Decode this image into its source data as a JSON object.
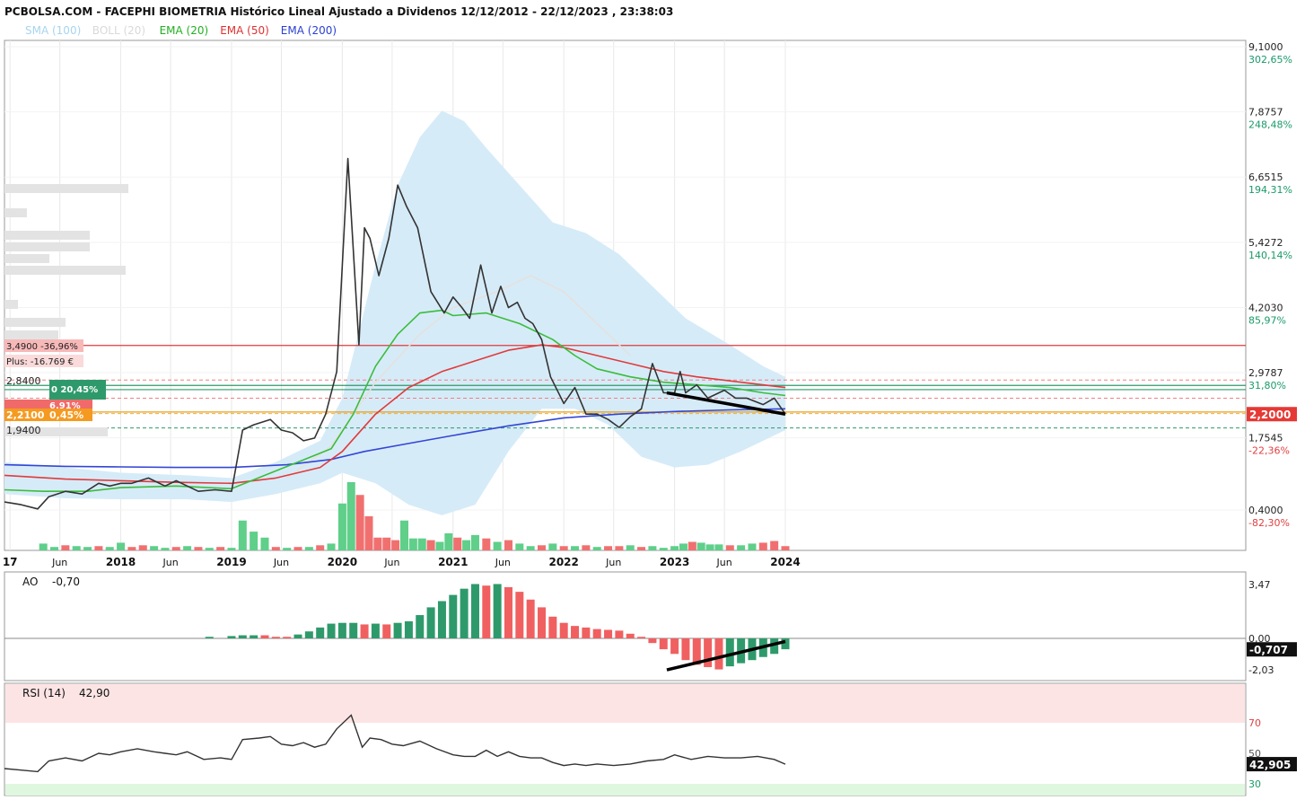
{
  "title": "PCBOLSA.COM - FACEPHI BIOMETRIA Histórico Lineal Ajustado a Dividenos 12/12/2012 - 22/12/2023 , 23:38:03",
  "legend": [
    {
      "text": "SMA (100)",
      "color": "#a8d4ef"
    },
    {
      "text": "BOLL (20)",
      "color": "#d9d9d9"
    },
    {
      "text": "EMA (20)",
      "color": "#21b021"
    },
    {
      "text": "EMA (50)",
      "color": "#e03030"
    },
    {
      "text": "EMA (200)",
      "color": "#2b3fd0"
    }
  ],
  "colors": {
    "price": "#333333",
    "boll_fill": "#d6ebf8",
    "sma100": "#e6e0da",
    "ema20": "#3bbd3b",
    "ema50": "#e03b3b",
    "ema200": "#3346d6",
    "vol_up": "#5fcf8a",
    "vol_down": "#f07070",
    "ao_up": "#2e9a6b",
    "ao_down": "#f06060",
    "grid": "#e8e8e8",
    "axis": "#000000",
    "trend": "#000000"
  },
  "x_axis": {
    "labels": [
      {
        "text": "17",
        "date": 2017.0,
        "bold": true
      },
      {
        "text": "Jun",
        "date": 2017.45,
        "bold": false
      },
      {
        "text": "2018",
        "date": 2018.0,
        "bold": true
      },
      {
        "text": "Jun",
        "date": 2018.45,
        "bold": false
      },
      {
        "text": "2019",
        "date": 2019.0,
        "bold": true
      },
      {
        "text": "Jun",
        "date": 2019.45,
        "bold": false
      },
      {
        "text": "2020",
        "date": 2020.0,
        "bold": true
      },
      {
        "text": "Jun",
        "date": 2020.45,
        "bold": false
      },
      {
        "text": "2021",
        "date": 2021.0,
        "bold": true
      },
      {
        "text": "Jun",
        "date": 2021.45,
        "bold": false
      },
      {
        "text": "2022",
        "date": 2022.0,
        "bold": true
      },
      {
        "text": "Jun",
        "date": 2022.45,
        "bold": false
      },
      {
        "text": "2023",
        "date": 2023.0,
        "bold": true
      },
      {
        "text": "Jun",
        "date": 2023.45,
        "bold": false
      },
      {
        "text": "2024",
        "date": 2024.0,
        "bold": true
      }
    ]
  },
  "price_axis": [
    {
      "value": "9,1000",
      "pct": "302,65%",
      "pct_color": "#1a9a6a",
      "price": 9.1
    },
    {
      "value": "7,8757",
      "pct": "248,48%",
      "pct_color": "#1a9a6a",
      "price": 7.8757
    },
    {
      "value": "6,6515",
      "pct": "194,31%",
      "pct_color": "#1a9a6a",
      "price": 6.6515
    },
    {
      "value": "5,4272",
      "pct": "140,14%",
      "pct_color": "#1a9a6a",
      "price": 5.4272
    },
    {
      "value": "4,2030",
      "pct": "85,97%",
      "pct_color": "#1a9a6a",
      "price": 4.203
    },
    {
      "value": "2,9787",
      "pct": "31,80%",
      "pct_color": "#1a9a6a",
      "price": 2.9787
    },
    {
      "value": "1,7545",
      "pct": "-22,36%",
      "pct_color": "#e04040",
      "price": 1.7545
    },
    {
      "value": "0,4000",
      "pct": "-82,30%",
      "pct_color": "#e04040",
      "price": 0.4
    }
  ],
  "current_price": "2,2000",
  "left_labels": {
    "resistance": "3,4900  -36,96%",
    "plus": "Plus: -16.769 €",
    "level_2840": "2,8400",
    "green_box": "0  20,45%",
    "red_box": "6,91%",
    "orange_value": "2,2100",
    "orange_pct": "0,45%",
    "level_1940": "1,9400"
  },
  "horizontal_lines": [
    {
      "price": 3.49,
      "color": "#e03b3b",
      "dash": false
    },
    {
      "price": 2.84,
      "color": "#f08080",
      "dash": true
    },
    {
      "price": 2.74,
      "color": "#2e9a6b",
      "dash": false
    },
    {
      "price": 2.66,
      "color": "#2e9a6b",
      "dash": false
    },
    {
      "price": 2.5,
      "color": "#f08080",
      "dash": true
    },
    {
      "price": 2.24,
      "color": "#e0a020",
      "dash": false
    },
    {
      "price": 2.21,
      "color": "#f0b040",
      "dash": true
    },
    {
      "price": 1.94,
      "color": "#2e9a6b",
      "dash": true
    }
  ],
  "ao": {
    "label": "AO",
    "value": "-0,70",
    "ticks": [
      {
        "text": "3,47",
        "v": 3.47
      },
      {
        "text": "0,00",
        "v": 0
      },
      {
        "text": "-2,03",
        "v": -2.03
      }
    ],
    "current": "-0,707"
  },
  "rsi": {
    "label": "RSI (14)",
    "value": "42,90",
    "ticks": [
      {
        "text": "70",
        "v": 70,
        "color": "#e04040"
      },
      {
        "text": "50",
        "v": 50,
        "color": "#555555"
      },
      {
        "text": "30",
        "v": 30,
        "color": "#1a9a6a"
      }
    ],
    "current": "42,905"
  },
  "chart_data": {
    "type": "line",
    "x_unit": "year (decimal)",
    "price": {
      "x": [
        2016.95,
        2017.1,
        2017.25,
        2017.35,
        2017.5,
        2017.65,
        2017.8,
        2017.9,
        2018.0,
        2018.1,
        2018.25,
        2018.3,
        2018.4,
        2018.5,
        2018.6,
        2018.7,
        2018.85,
        2019.0,
        2019.1,
        2019.2,
        2019.35,
        2019.45,
        2019.55,
        2019.65,
        2019.75,
        2019.85,
        2019.95,
        2020.05,
        2020.15,
        2020.2,
        2020.25,
        2020.33,
        2020.42,
        2020.5,
        2020.58,
        2020.68,
        2020.8,
        2020.92,
        2021.0,
        2021.08,
        2021.15,
        2021.25,
        2021.35,
        2021.43,
        2021.5,
        2021.58,
        2021.65,
        2021.72,
        2021.8,
        2021.88,
        2022.0,
        2022.1,
        2022.2,
        2022.3,
        2022.4,
        2022.5,
        2022.6,
        2022.7,
        2022.8,
        2022.9,
        2023.0,
        2023.05,
        2023.1,
        2023.2,
        2023.3,
        2023.45,
        2023.55,
        2023.65,
        2023.8,
        2023.9,
        2024.0
      ],
      "y": [
        0.55,
        0.5,
        0.42,
        0.65,
        0.75,
        0.7,
        0.9,
        0.85,
        0.9,
        0.9,
        1.0,
        0.95,
        0.85,
        0.95,
        0.85,
        0.75,
        0.78,
        0.75,
        1.9,
        2.0,
        2.1,
        1.9,
        1.85,
        1.7,
        1.75,
        2.2,
        3.0,
        7.0,
        3.5,
        5.7,
        5.5,
        4.8,
        5.5,
        6.5,
        6.1,
        5.7,
        4.5,
        4.1,
        4.4,
        4.2,
        4.0,
        5.0,
        4.1,
        4.6,
        4.2,
        4.3,
        4.0,
        3.9,
        3.6,
        2.9,
        2.4,
        2.7,
        2.2,
        2.2,
        2.1,
        1.95,
        2.15,
        2.3,
        3.15,
        2.6,
        2.6,
        3.0,
        2.6,
        2.75,
        2.5,
        2.65,
        2.5,
        2.5,
        2.38,
        2.5,
        2.2
      ]
    },
    "ema20": {
      "x": [
        2016.95,
        2017.3,
        2017.7,
        2018.0,
        2018.5,
        2019.0,
        2019.3,
        2019.6,
        2019.9,
        2020.1,
        2020.3,
        2020.5,
        2020.7,
        2020.9,
        2021.0,
        2021.3,
        2021.6,
        2021.9,
        2022.1,
        2022.3,
        2022.6,
        2022.9,
        2023.2,
        2023.5,
        2023.8,
        2024.0
      ],
      "y": [
        0.78,
        0.75,
        0.75,
        0.82,
        0.85,
        0.8,
        1.05,
        1.3,
        1.55,
        2.2,
        3.1,
        3.7,
        4.1,
        4.15,
        4.05,
        4.1,
        3.9,
        3.6,
        3.3,
        3.05,
        2.9,
        2.8,
        2.75,
        2.7,
        2.6,
        2.55
      ]
    },
    "ema50": {
      "x": [
        2016.95,
        2017.5,
        2018.0,
        2018.5,
        2019.0,
        2019.4,
        2019.8,
        2020.0,
        2020.3,
        2020.6,
        2020.9,
        2021.2,
        2021.5,
        2021.8,
        2022.0,
        2022.3,
        2022.6,
        2022.9,
        2023.2,
        2023.6,
        2024.0
      ],
      "y": [
        1.05,
        0.98,
        0.95,
        0.92,
        0.9,
        1.0,
        1.2,
        1.5,
        2.2,
        2.7,
        3.0,
        3.2,
        3.4,
        3.5,
        3.45,
        3.3,
        3.15,
        3.0,
        2.9,
        2.8,
        2.7
      ]
    },
    "ema200": {
      "x": [
        2016.95,
        2017.5,
        2018.0,
        2018.5,
        2019.0,
        2019.5,
        2019.9,
        2020.2,
        2020.6,
        2021.0,
        2021.5,
        2022.0,
        2022.5,
        2023.0,
        2023.5,
        2024.0
      ],
      "y": [
        1.25,
        1.22,
        1.21,
        1.2,
        1.2,
        1.25,
        1.35,
        1.5,
        1.65,
        1.8,
        1.98,
        2.13,
        2.2,
        2.25,
        2.28,
        2.3
      ]
    },
    "sma100": {
      "x": [
        2019.5,
        2019.9,
        2020.3,
        2020.7,
        2021.0,
        2021.4,
        2021.7,
        2022.0,
        2022.3,
        2022.6
      ],
      "y": [
        1.0,
        1.6,
        2.8,
        3.7,
        4.2,
        4.5,
        4.8,
        4.5,
        3.9,
        3.3
      ]
    },
    "boll_upper": {
      "x": [
        2016.95,
        2017.5,
        2018.0,
        2018.6,
        2019.0,
        2019.4,
        2019.8,
        2020.0,
        2020.3,
        2020.5,
        2020.7,
        2020.9,
        2021.1,
        2021.3,
        2021.6,
        2021.9,
        2022.2,
        2022.5,
        2022.8,
        2023.1,
        2023.5,
        2023.8,
        2024.0
      ],
      "y": [
        1.3,
        1.2,
        1.1,
        1.05,
        1.0,
        1.3,
        1.7,
        2.5,
        5.0,
        6.5,
        7.4,
        7.9,
        7.7,
        7.2,
        6.5,
        5.8,
        5.6,
        5.2,
        4.6,
        4.0,
        3.5,
        3.1,
        2.9
      ]
    },
    "boll_lower": {
      "x": [
        2016.95,
        2017.5,
        2018.0,
        2018.6,
        2019.0,
        2019.4,
        2019.8,
        2020.0,
        2020.3,
        2020.6,
        2020.9,
        2021.2,
        2021.5,
        2021.8,
        2022.1,
        2022.4,
        2022.7,
        2023.0,
        2023.3,
        2023.6,
        2024.0
      ],
      "y": [
        0.7,
        0.62,
        0.6,
        0.6,
        0.55,
        0.7,
        0.9,
        1.1,
        0.9,
        0.5,
        0.3,
        0.5,
        1.5,
        2.3,
        2.3,
        2.0,
        1.4,
        1.2,
        1.25,
        1.5,
        1.9
      ]
    },
    "volume": {
      "x": [
        2017.3,
        2017.4,
        2017.5,
        2017.6,
        2017.7,
        2017.8,
        2017.9,
        2018.0,
        2018.1,
        2018.2,
        2018.3,
        2018.4,
        2018.5,
        2018.6,
        2018.7,
        2018.8,
        2018.9,
        2019.0,
        2019.1,
        2019.2,
        2019.3,
        2019.4,
        2019.5,
        2019.6,
        2019.7,
        2019.8,
        2019.9,
        2020.0,
        2020.08,
        2020.16,
        2020.24,
        2020.32,
        2020.4,
        2020.48,
        2020.56,
        2020.64,
        2020.72,
        2020.8,
        2020.88,
        2020.96,
        2021.04,
        2021.12,
        2021.2,
        2021.3,
        2021.4,
        2021.5,
        2021.6,
        2021.7,
        2021.8,
        2021.9,
        2022.0,
        2022.1,
        2022.2,
        2022.3,
        2022.4,
        2022.5,
        2022.6,
        2022.7,
        2022.8,
        2022.9,
        2023.0,
        2023.08,
        2023.16,
        2023.24,
        2023.32,
        2023.4,
        2023.5,
        2023.6,
        2023.7,
        2023.8,
        2023.9,
        2024.0
      ],
      "v": [
        8,
        4,
        6,
        5,
        4,
        5,
        4,
        9,
        4,
        6,
        5,
        3,
        4,
        5,
        4,
        3,
        4,
        3,
        35,
        22,
        15,
        4,
        3,
        4,
        4,
        6,
        8,
        55,
        80,
        65,
        40,
        15,
        15,
        12,
        35,
        14,
        14,
        12,
        10,
        20,
        15,
        12,
        18,
        14,
        10,
        12,
        8,
        5,
        6,
        8,
        5,
        5,
        6,
        4,
        5,
        5,
        6,
        4,
        5,
        3,
        5,
        8,
        10,
        9,
        7,
        7,
        6,
        6,
        8,
        9,
        11,
        5
      ],
      "up": [
        true,
        true,
        false,
        true,
        true,
        false,
        true,
        true,
        false,
        false,
        true,
        true,
        false,
        true,
        false,
        true,
        false,
        true,
        true,
        true,
        true,
        false,
        true,
        false,
        true,
        false,
        true,
        true,
        true,
        false,
        false,
        false,
        false,
        false,
        true,
        true,
        true,
        false,
        true,
        true,
        false,
        true,
        true,
        false,
        true,
        false,
        true,
        true,
        false,
        true,
        false,
        true,
        false,
        true,
        false,
        false,
        true,
        false,
        true,
        true,
        true,
        true,
        false,
        true,
        true,
        true,
        false,
        true,
        true,
        false,
        false,
        false
      ]
    },
    "ao": {
      "x": [
        2018.8,
        2019.0,
        2019.1,
        2019.2,
        2019.3,
        2019.4,
        2019.5,
        2019.6,
        2019.7,
        2019.8,
        2019.9,
        2020.0,
        2020.1,
        2020.2,
        2020.3,
        2020.4,
        2020.5,
        2020.6,
        2020.7,
        2020.8,
        2020.9,
        2021.0,
        2021.1,
        2021.2,
        2021.3,
        2021.4,
        2021.5,
        2021.6,
        2021.7,
        2021.8,
        2021.9,
        2022.0,
        2022.1,
        2022.2,
        2022.3,
        2022.4,
        2022.5,
        2022.6,
        2022.7,
        2022.8,
        2022.9,
        2023.0,
        2023.1,
        2023.2,
        2023.3,
        2023.4,
        2023.5,
        2023.6,
        2023.7,
        2023.8,
        2023.9,
        2024.0
      ],
      "v": [
        0.1,
        0.15,
        0.2,
        0.2,
        0.2,
        0.1,
        0.1,
        0.25,
        0.45,
        0.7,
        0.95,
        1.0,
        1.0,
        0.9,
        0.95,
        0.9,
        1.0,
        1.1,
        1.5,
        2.0,
        2.4,
        2.8,
        3.2,
        3.5,
        3.4,
        3.5,
        3.3,
        3.0,
        2.5,
        2.0,
        1.4,
        1.0,
        0.8,
        0.7,
        0.6,
        0.55,
        0.5,
        0.3,
        0.1,
        -0.3,
        -0.7,
        -1.0,
        -1.4,
        -1.7,
        -1.85,
        -2.0,
        -1.8,
        -1.6,
        -1.4,
        -1.2,
        -1.0,
        -0.7
      ],
      "up": [
        true,
        true,
        true,
        true,
        false,
        false,
        false,
        true,
        true,
        true,
        true,
        true,
        true,
        false,
        true,
        false,
        true,
        true,
        true,
        true,
        true,
        true,
        true,
        true,
        false,
        true,
        false,
        false,
        false,
        false,
        false,
        false,
        false,
        false,
        false,
        false,
        false,
        false,
        false,
        false,
        false,
        false,
        false,
        false,
        false,
        false,
        true,
        true,
        true,
        true,
        true,
        true
      ]
    },
    "rsi": {
      "x": [
        2016.95,
        2017.1,
        2017.25,
        2017.35,
        2017.5,
        2017.65,
        2017.8,
        2017.9,
        2018.0,
        2018.15,
        2018.3,
        2018.4,
        2018.5,
        2018.6,
        2018.75,
        2018.9,
        2019.0,
        2019.1,
        2019.25,
        2019.35,
        2019.45,
        2019.55,
        2019.65,
        2019.75,
        2019.85,
        2019.95,
        2020.08,
        2020.18,
        2020.25,
        2020.35,
        2020.45,
        2020.55,
        2020.7,
        2020.85,
        2021.0,
        2021.1,
        2021.2,
        2021.3,
        2021.4,
        2021.5,
        2021.6,
        2021.7,
        2021.8,
        2021.9,
        2022.0,
        2022.1,
        2022.2,
        2022.3,
        2022.45,
        2022.6,
        2022.75,
        2022.9,
        2023.0,
        2023.05,
        2023.15,
        2023.3,
        2023.45,
        2023.6,
        2023.75,
        2023.9,
        2024.0
      ],
      "v": [
        40,
        39,
        38,
        45,
        47,
        45,
        50,
        49,
        51,
        53,
        51,
        50,
        49,
        51,
        46,
        47,
        46,
        59,
        60,
        61,
        56,
        55,
        57,
        54,
        56,
        66,
        75,
        54,
        60,
        59,
        56,
        55,
        58,
        53,
        49,
        48,
        48,
        52,
        48,
        51,
        48,
        47,
        47,
        44,
        42,
        43,
        42,
        43,
        42,
        43,
        45,
        46,
        49,
        48,
        46,
        48,
        47,
        47,
        48,
        46,
        42.9
      ]
    }
  }
}
